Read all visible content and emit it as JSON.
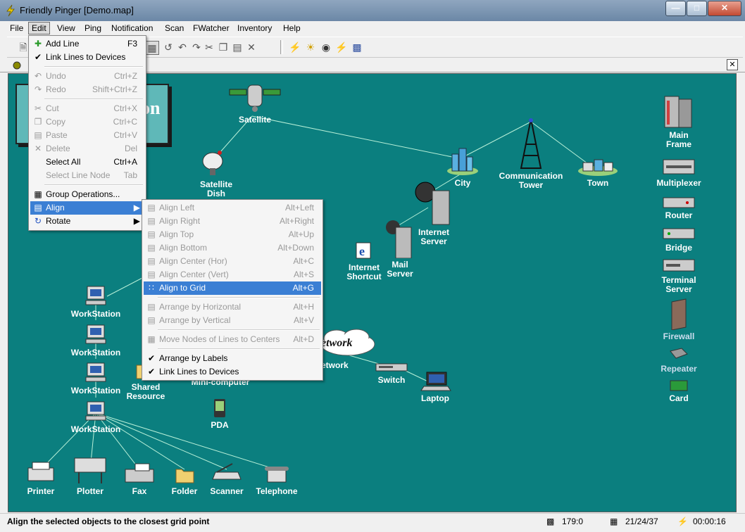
{
  "window": {
    "title": "Friendly Pinger [Demo.map]"
  },
  "menubar": {
    "items": [
      "File",
      "Edit",
      "View",
      "Ping",
      "Notification",
      "Scan",
      "FWatcher",
      "Inventory",
      "Help"
    ]
  },
  "edit_menu": {
    "items": [
      {
        "label": "Add Line",
        "shortcut": "F3",
        "icon": "add-line-icon"
      },
      {
        "label": "Link Lines to Devices",
        "shortcut": "",
        "icon": "check-icon"
      },
      {
        "label": "Undo",
        "shortcut": "Ctrl+Z",
        "icon": "undo-icon"
      },
      {
        "label": "Redo",
        "shortcut": "Shift+Ctrl+Z",
        "icon": "redo-icon"
      },
      {
        "label": "Cut",
        "shortcut": "Ctrl+X",
        "icon": "cut-icon"
      },
      {
        "label": "Copy",
        "shortcut": "Ctrl+C",
        "icon": "copy-icon"
      },
      {
        "label": "Paste",
        "shortcut": "Ctrl+V",
        "icon": "paste-icon"
      },
      {
        "label": "Delete",
        "shortcut": "Del",
        "icon": "delete-icon"
      },
      {
        "label": "Select All",
        "shortcut": "Ctrl+A",
        "icon": ""
      },
      {
        "label": "Select Line Node",
        "shortcut": "Tab",
        "icon": ""
      },
      {
        "label": "Group Operations...",
        "shortcut": "",
        "icon": "group-icon"
      },
      {
        "label": "Align",
        "shortcut": "",
        "icon": "align-icon"
      },
      {
        "label": "Rotate",
        "shortcut": "",
        "icon": "rotate-icon"
      }
    ]
  },
  "align_menu": {
    "items": [
      {
        "label": "Align Left",
        "shortcut": "Alt+Left"
      },
      {
        "label": "Align Right",
        "shortcut": "Alt+Right"
      },
      {
        "label": "Align Top",
        "shortcut": "Alt+Up"
      },
      {
        "label": "Align Bottom",
        "shortcut": "Alt+Down"
      },
      {
        "label": "Align Center (Hor)",
        "shortcut": "Alt+C"
      },
      {
        "label": "Align Center (Vert)",
        "shortcut": "Alt+S"
      },
      {
        "label": "Align to Grid",
        "shortcut": "Alt+G"
      },
      {
        "label": "Arrange by Horizontal",
        "shortcut": "Alt+H"
      },
      {
        "label": "Arrange by Vertical",
        "shortcut": "Alt+V"
      },
      {
        "label": "Move Nodes of Lines to Centers",
        "shortcut": "Alt+D"
      },
      {
        "label": "Arrange by Labels",
        "shortcut": ""
      },
      {
        "label": "Link Lines to Devices",
        "shortcut": ""
      }
    ]
  },
  "map": {
    "banner_text": "on",
    "network_cloud_text": "etwork",
    "nodes": {
      "satellite": "Satellite",
      "satellite_dish": "Satellite\nDish",
      "city": "City",
      "comm_tower": "Communication\nTower",
      "town": "Town",
      "internet_server": "Internet\nServer",
      "internet_shortcut": "Internet\nShortcut",
      "mail_server": "Mail\nServer",
      "workstation1": "WorkStation",
      "workstation2": "WorkStation",
      "workstation3": "WorkStation",
      "workstation4": "WorkStation",
      "shared_resource": "Shared\nResource",
      "mini_computer": "Mini-computer",
      "pda": "PDA",
      "network": "etwork",
      "switch": "Switch",
      "laptop": "Laptop",
      "printer": "Printer",
      "plotter": "Plotter",
      "fax": "Fax",
      "folder": "Folder",
      "scanner": "Scanner",
      "telephone": "Telephone"
    },
    "palette": {
      "main_frame": "Main\nFrame",
      "multiplexer": "Multiplexer",
      "router": "Router",
      "bridge": "Bridge",
      "terminal_server": "Terminal\nServer",
      "firewall": "Firewall",
      "repeater": "Repeater",
      "card": "Card"
    }
  },
  "statusbar": {
    "message": "Align the selected objects to the closest grid point",
    "coords": "179:0",
    "counts": "21/24/37",
    "timer": "00:00:16"
  },
  "colors": {
    "canvas": "#0b7f7f",
    "line": "#b8f0d8",
    "highlight": "#3b7fd4"
  }
}
